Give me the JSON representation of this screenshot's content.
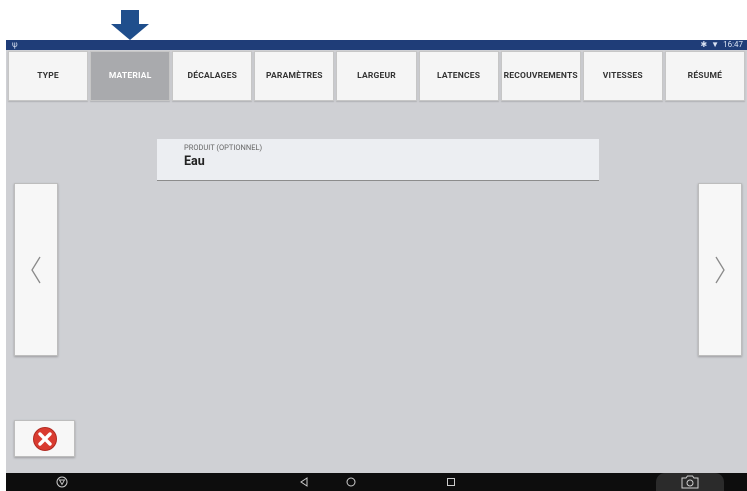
{
  "statusbar": {
    "time": "16:47"
  },
  "tabs": [
    {
      "label": "TYPE",
      "active": false
    },
    {
      "label": "MATERIAL",
      "active": true
    },
    {
      "label": "DÉCALAGES",
      "active": false
    },
    {
      "label": "PARAMÈTRES",
      "active": false
    },
    {
      "label": "LARGEUR",
      "active": false
    },
    {
      "label": "LATENCES",
      "active": false
    },
    {
      "label": "RECOUVREMENTS",
      "active": false
    },
    {
      "label": "VITESSES",
      "active": false
    },
    {
      "label": "RÉSUMÉ",
      "active": false
    }
  ],
  "product_field": {
    "label": "PRODUIT (OPTIONNEL)",
    "value": "Eau"
  },
  "icons": {
    "pointer": "down-arrow-icon",
    "prev": "chevron-left-icon",
    "next": "chevron-right-icon",
    "close": "close-icon",
    "back": "back-icon",
    "home": "home-icon",
    "recents": "recents-icon",
    "screenshot": "camera-icon",
    "vpn": "shield-icon"
  },
  "colors": {
    "pointer_arrow": "#1f4e8c",
    "statusbar": "#1f3d78",
    "active_tab": "#a9aaad",
    "close_red": "#d93b30",
    "background": "#cfd0d4"
  }
}
